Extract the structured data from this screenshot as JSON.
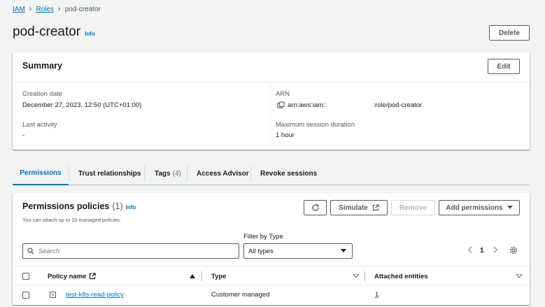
{
  "breadcrumb": {
    "items": [
      "IAM",
      "Roles"
    ],
    "current": "pod-creator"
  },
  "header": {
    "title": "pod-creator",
    "info": "Info",
    "delete_label": "Delete"
  },
  "summary": {
    "title": "Summary",
    "edit_label": "Edit",
    "creation_date_label": "Creation date",
    "creation_date_value": "December 27, 2023, 12:50 (UTC+01:00)",
    "last_activity_label": "Last activity",
    "last_activity_value": "-",
    "arn_label": "ARN",
    "arn_prefix": "arn:aws:iam::",
    "arn_suffix": ":role/pod-creator",
    "max_session_label": "Maximum session duration",
    "max_session_value": "1 hour"
  },
  "tabs": {
    "permissions": "Permissions",
    "trust": "Trust relationships",
    "tags": "Tags",
    "tags_count": "(4)",
    "access_advisor": "Access Advisor",
    "revoke": "Revoke sessions"
  },
  "permissions": {
    "title": "Permissions policies",
    "count": "(1)",
    "info": "Info",
    "description": "You can attach up to 10 managed policies.",
    "refresh_icon": "refresh-icon",
    "simulate_label": "Simulate",
    "remove_label": "Remove",
    "add_label": "Add permissions",
    "filter_label": "Filter by Type",
    "search_placeholder": "Search",
    "filter_value": "All types",
    "page_number": "1",
    "columns": {
      "policy_name": "Policy name",
      "type": "Type",
      "attached": "Attached entities"
    },
    "rows": [
      {
        "name": "test-k8s-read-policy",
        "type": "Customer managed",
        "attached": "1"
      }
    ]
  },
  "colors": {
    "link": "#0073bb",
    "text": "#16191f",
    "muted": "#545b64",
    "background": "#f2f3f3"
  }
}
